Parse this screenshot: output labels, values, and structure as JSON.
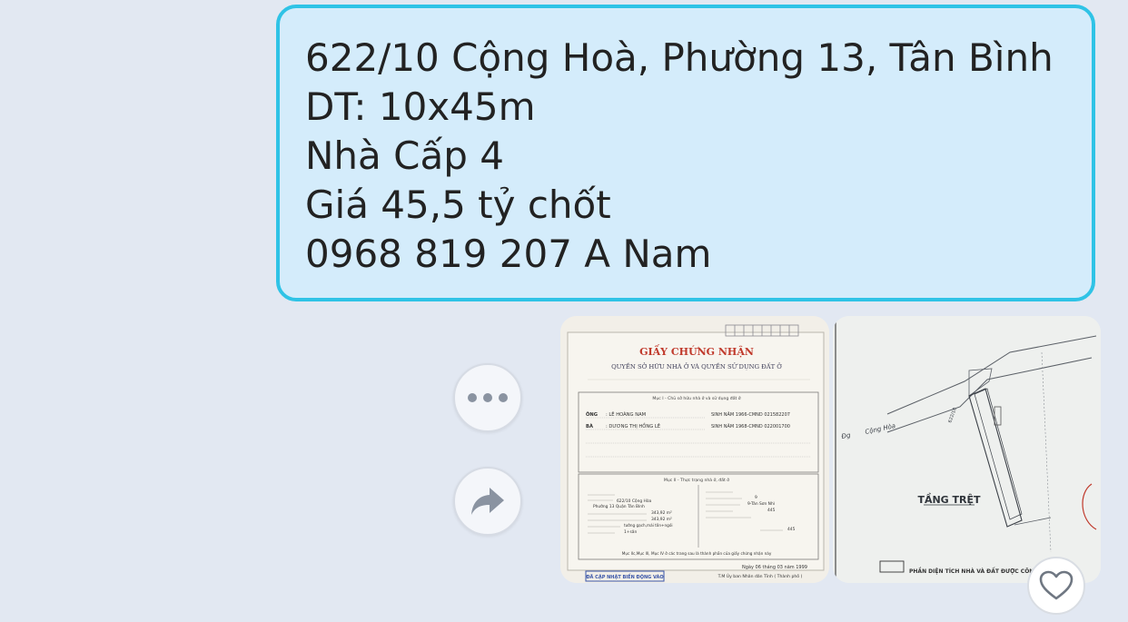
{
  "message": {
    "lines": [
      "622/10 Cộng Hoà, Phường 13, Tân Bình",
      "DT: 10x45m",
      "Nhà Cấp 4",
      "Giá 45,5 tỷ chốt",
      "0968 819 207 A Nam"
    ]
  },
  "actions": {
    "more_icon": "more-horizontal-icon",
    "share_icon": "share-arrow-icon",
    "like_icon": "heart-outline-icon"
  },
  "attachments": [
    {
      "kind": "document-photo",
      "title": "GIẤY CHỨNG NHẬN",
      "subtitle": "QUYỀN SỞ HỮU NHÀ Ở VÀ QUYỀN SỬ DỤNG ĐẤT Ở",
      "section_1": "Mục I - Chủ sở hữu nhà ở và sử dụng đất ở",
      "owner_1_label": "ÔNG",
      "owner_1_name": ": LÊ HOÀNG NAM",
      "owner_1_id": "SINH NĂM 1966-CMND 021582207",
      "owner_2_label": "BÀ",
      "owner_2_name": ": DƯƠNG THỊ HỒNG LÊ",
      "owner_2_id": "SINH NĂM 1968-CMND 022001700",
      "section_2": "Mục II - Thực trạng nhà ở, đất ở",
      "house_address": "622/10 Cộng Hòa",
      "house_ward": "Phường 13 Quận Tân Bình",
      "floor_area": "343,92 m²",
      "build_area": "343,92 m²",
      "structure": "tường gạch,mái tôn+ngói",
      "floors": "1+sân",
      "plot": "9",
      "map_sheet": "9-Tân Sơn Nhì",
      "land_area": "445",
      "private_area": "445",
      "section_footer": "Mục IIc,Mục III, Mục IV ở các trang sau là thành phần của giấy chứng nhận này",
      "date_text": "Ngày 06 tháng 03 năm 1999",
      "authority": "T.M Ủy ban Nhân dân Tỉnh ( Thành phố )",
      "stamp_text": "ĐÃ CẬP NHẬT BIẾN ĐỘNG VÀO"
    },
    {
      "kind": "floor-plan-photo",
      "street_label": "Cộng Hòa",
      "plan_title": "TẦNG TRỆT",
      "number_label": "622/10",
      "legend_text": "PHẦN DIỆN TÍCH NHÀ VÀ ĐẤT ĐƯỢC CÔNG"
    }
  ]
}
